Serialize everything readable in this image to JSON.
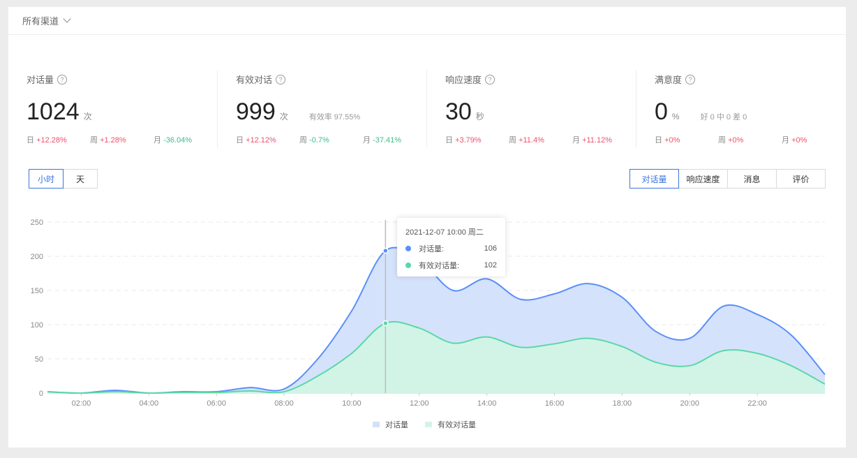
{
  "channel": {
    "label": "所有渠道"
  },
  "stats": [
    {
      "title": "对话量",
      "value": "1024",
      "unit": "次",
      "extra": "",
      "changes": [
        {
          "label": "日",
          "value": "+12.28%",
          "dir": "up"
        },
        {
          "label": "周",
          "value": "+1.28%",
          "dir": "up"
        },
        {
          "label": "月",
          "value": "-36.04%",
          "dir": "dn"
        }
      ]
    },
    {
      "title": "有效对话",
      "value": "999",
      "unit": "次",
      "extra": "有效率 97.55%",
      "changes": [
        {
          "label": "日",
          "value": "+12.12%",
          "dir": "up"
        },
        {
          "label": "周",
          "value": "-0.7%",
          "dir": "dn"
        },
        {
          "label": "月",
          "value": "-37.41%",
          "dir": "dn"
        }
      ]
    },
    {
      "title": "响应速度",
      "value": "30",
      "unit": "秒",
      "extra": "",
      "changes": [
        {
          "label": "日",
          "value": "+3.79%",
          "dir": "up"
        },
        {
          "label": "周",
          "value": "+11.4%",
          "dir": "up"
        },
        {
          "label": "月",
          "value": "+11.12%",
          "dir": "up"
        }
      ]
    },
    {
      "title": "满意度",
      "value": "0",
      "unit": "%",
      "extra": "好 0 中 0 差 0",
      "changes": [
        {
          "label": "日",
          "value": "+0%",
          "dir": "up"
        },
        {
          "label": "周",
          "value": "+0%",
          "dir": "up"
        },
        {
          "label": "月",
          "value": "+0%",
          "dir": "up"
        }
      ]
    }
  ],
  "time_toggle": [
    {
      "label": "小时",
      "active": true
    },
    {
      "label": "天",
      "active": false
    }
  ],
  "metric_tabs": [
    {
      "label": "对话量",
      "active": true
    },
    {
      "label": "响应速度",
      "active": false
    },
    {
      "label": "消息",
      "active": false
    },
    {
      "label": "评价",
      "active": false
    }
  ],
  "tooltip": {
    "title": "2021-12-07 10:00 周二",
    "rows": [
      {
        "name": "对话量:",
        "value": "106"
      },
      {
        "name": "有效对话量:",
        "value": "102"
      }
    ]
  },
  "chart_data": {
    "type": "area",
    "x": [
      1,
      2,
      3,
      4,
      5,
      6,
      7,
      8,
      9,
      10,
      11,
      12,
      13,
      14,
      15,
      16,
      17,
      18,
      19,
      20,
      21,
      22,
      23,
      24
    ],
    "xticks": [
      {
        "x": 2,
        "label": "02:00"
      },
      {
        "x": 4,
        "label": "04:00"
      },
      {
        "x": 6,
        "label": "06:00"
      },
      {
        "x": 8,
        "label": "08:00"
      },
      {
        "x": 10,
        "label": "10:00"
      },
      {
        "x": 12,
        "label": "12:00"
      },
      {
        "x": 14,
        "label": "14:00"
      },
      {
        "x": 16,
        "label": "16:00"
      },
      {
        "x": 18,
        "label": "18:00"
      },
      {
        "x": 20,
        "label": "20:00"
      },
      {
        "x": 22,
        "label": "22:00"
      }
    ],
    "yticks": [
      0,
      50,
      100,
      150,
      200,
      250
    ],
    "ylim": [
      0,
      250
    ],
    "highlight_x": 11,
    "series": [
      {
        "name": "对话量",
        "color": "#5b8ff9",
        "fill": "#d3e0fb",
        "values": [
          2,
          0,
          4,
          0,
          2,
          2,
          8,
          6,
          50,
          120,
          208,
          195,
          150,
          167,
          137,
          145,
          160,
          140,
          90,
          80,
          127,
          115,
          85,
          27
        ]
      },
      {
        "name": "有效对话量",
        "color": "#5ad8a6",
        "fill": "#d2f4e6",
        "values": [
          2,
          0,
          2,
          0,
          1,
          1,
          3,
          2,
          25,
          58,
          102,
          95,
          73,
          82,
          67,
          72,
          80,
          68,
          45,
          40,
          62,
          58,
          40,
          13
        ]
      }
    ],
    "legend": "bottom-center"
  }
}
